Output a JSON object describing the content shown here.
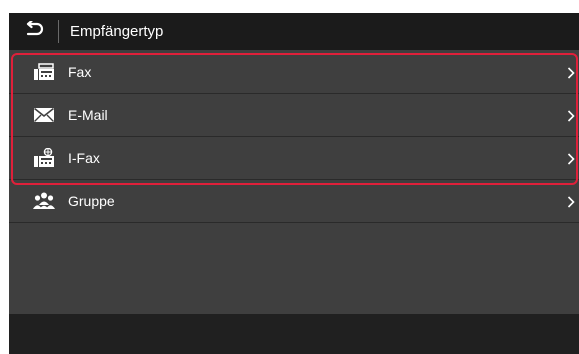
{
  "header": {
    "back_icon": "back-arrow-icon",
    "title": "Empfängertyp"
  },
  "items": [
    {
      "label": "Fax",
      "icon": "fax-icon"
    },
    {
      "label": "E-Mail",
      "icon": "envelope-icon"
    },
    {
      "label": "I-Fax",
      "icon": "internet-fax-icon"
    },
    {
      "label": "Gruppe",
      "icon": "group-icon"
    }
  ],
  "colors": {
    "screen_bg": "#3f3f3f",
    "header_bg": "#1b1b1b",
    "bottom_bar_bg": "#202020",
    "text": "#ffffff",
    "highlight_border": "#e0203a"
  }
}
